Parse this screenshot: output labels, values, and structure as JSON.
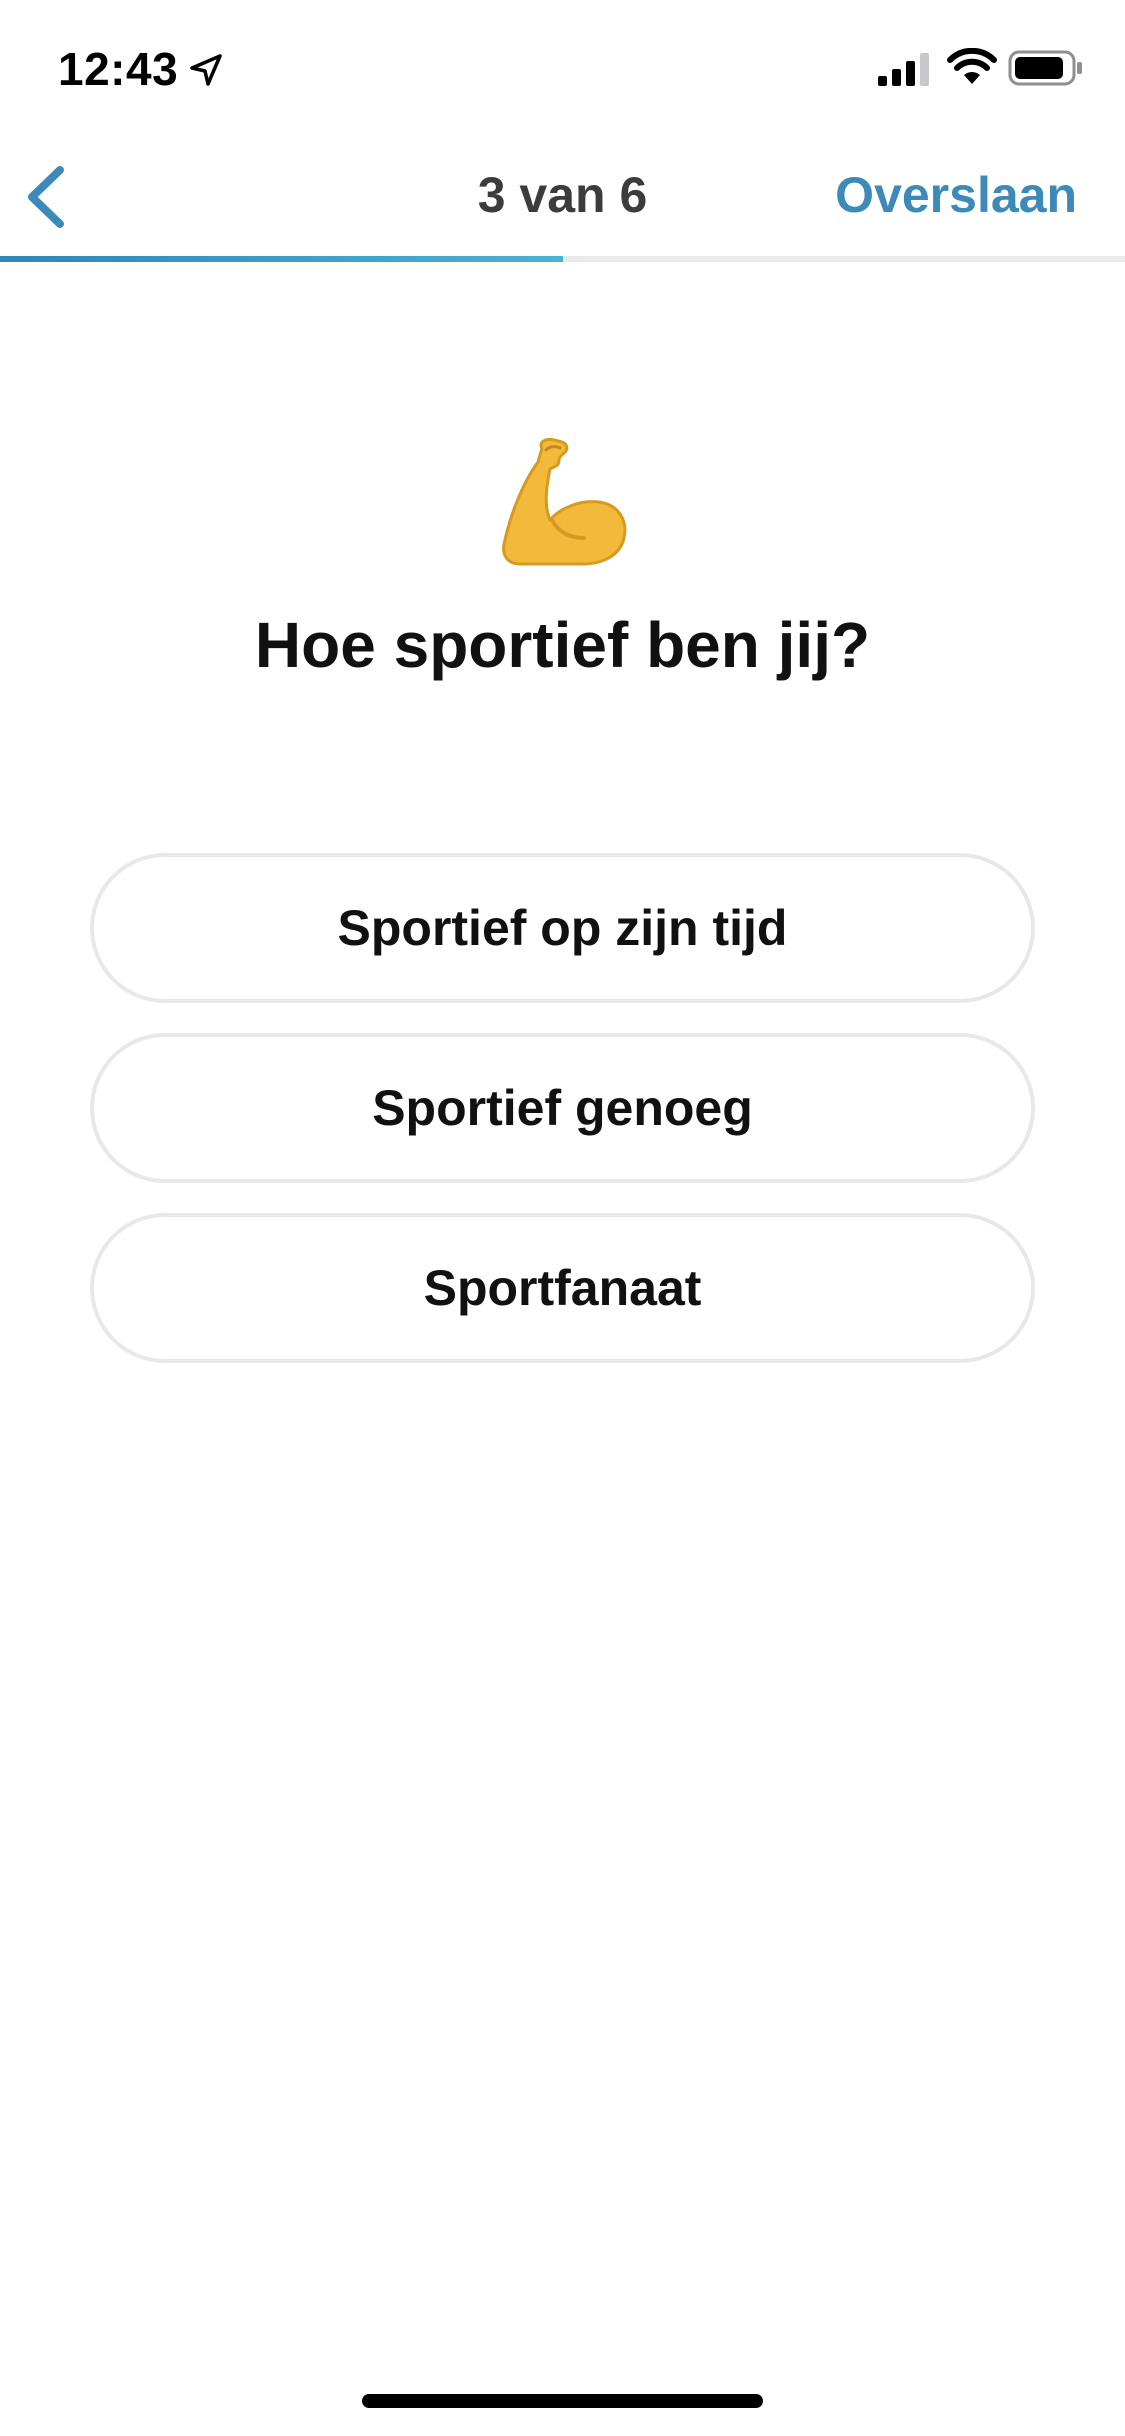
{
  "status_bar": {
    "time": "12:43",
    "icons": [
      "location-arrow-icon",
      "signal-icon",
      "wifi-icon",
      "battery-icon"
    ]
  },
  "nav": {
    "title": "3 van 6",
    "skip_label": "Overslaan",
    "back_icon": "chevron-left-icon",
    "progress_fraction": 0.5,
    "accent_color": "#3d8ab9"
  },
  "question": {
    "emoji": "💪",
    "title": "Hoe sportief ben jij?"
  },
  "options": [
    {
      "label": "Sportief op zijn tijd"
    },
    {
      "label": "Sportief genoeg"
    },
    {
      "label": "Sportfanaat"
    }
  ]
}
